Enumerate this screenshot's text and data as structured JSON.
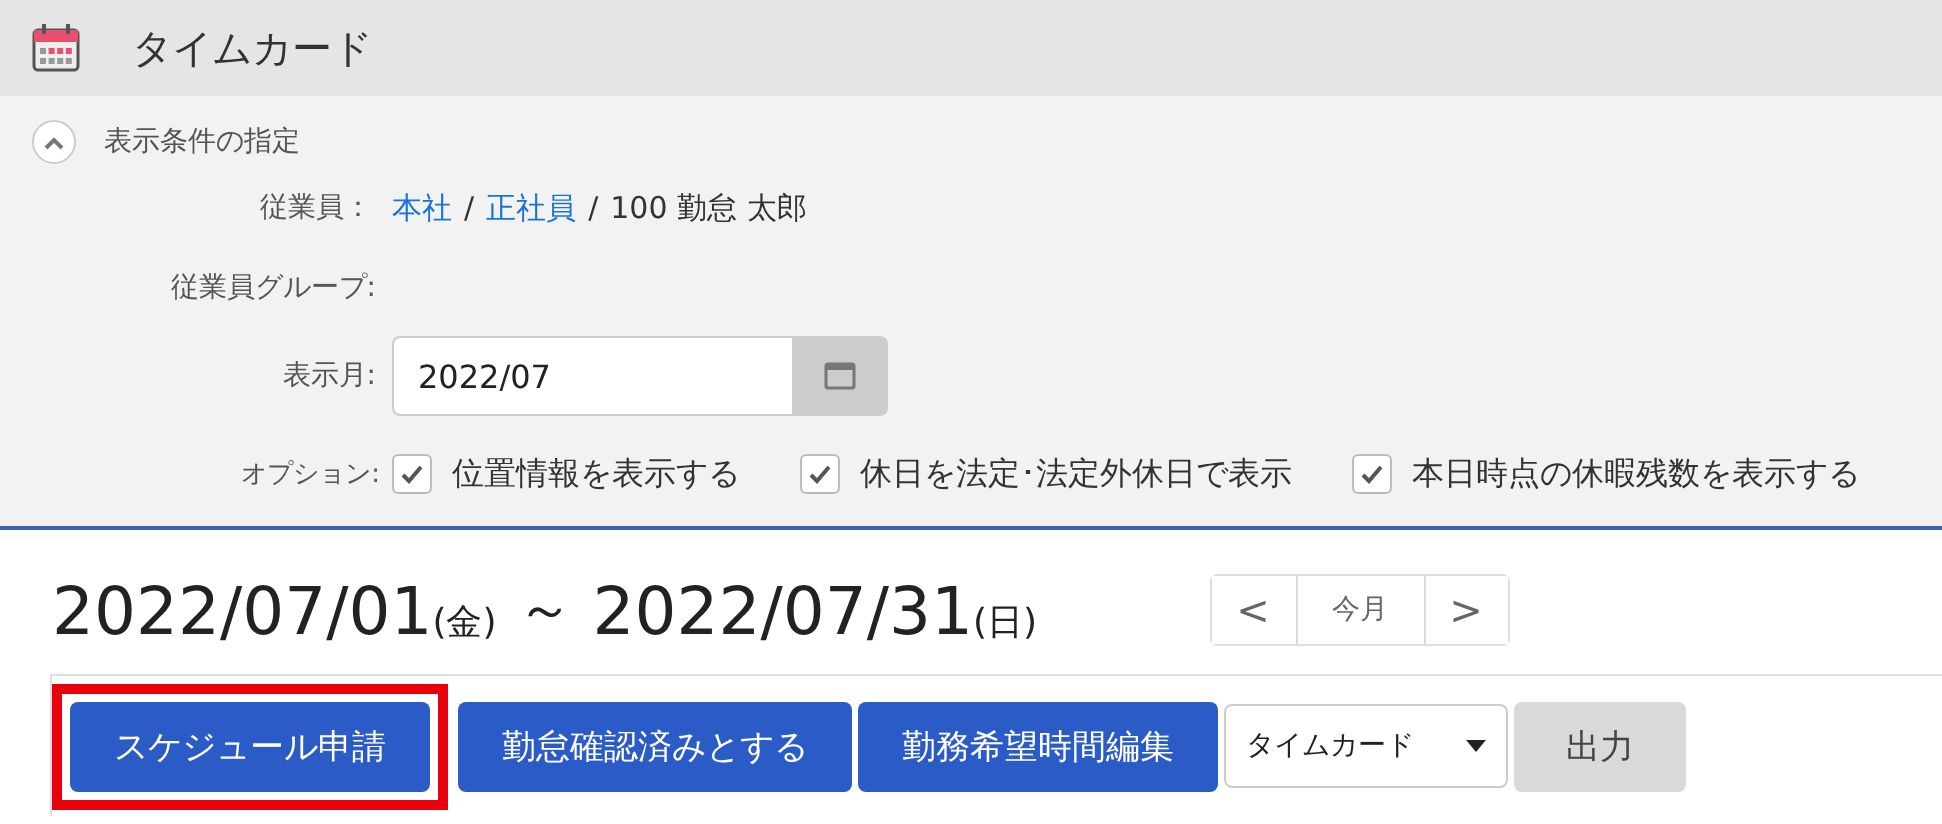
{
  "header": {
    "title": "タイムカード"
  },
  "conditions": {
    "title": "表示条件の指定",
    "expanded": true,
    "employee": {
      "label": "従業員：",
      "links": [
        "本社",
        "正社員"
      ],
      "separator": "/",
      "name": "100 勤怠 太郎"
    },
    "group": {
      "label": "従業員グループ:"
    },
    "month": {
      "label": "表示月:",
      "value": "2022/07"
    },
    "options": {
      "label": "オプション:",
      "items": [
        {
          "label": "位置情報を表示する",
          "checked": true
        },
        {
          "label": "休日を法定･法定外休日で表示",
          "checked": true
        },
        {
          "label": "本日時点の休暇残数を表示する",
          "checked": true
        }
      ]
    }
  },
  "period": {
    "start": "2022/07/01",
    "start_day": "(金)",
    "tilde": "～",
    "end": "2022/07/31",
    "end_day": "(日)"
  },
  "nav": {
    "prev": "<",
    "today": "今月",
    "next": ">"
  },
  "toolbar": [
    {
      "kind": "primary",
      "label": "スケジュール申請",
      "highlighted": true
    },
    {
      "kind": "primary",
      "label": "勤怠確認済みとする",
      "highlighted": false
    },
    {
      "kind": "primary",
      "label": "勤務希望時間編集",
      "highlighted": false
    },
    {
      "kind": "select",
      "label": "タイムカード",
      "highlighted": false
    },
    {
      "kind": "secondary",
      "label": "出力",
      "highlighted": false
    }
  ]
}
